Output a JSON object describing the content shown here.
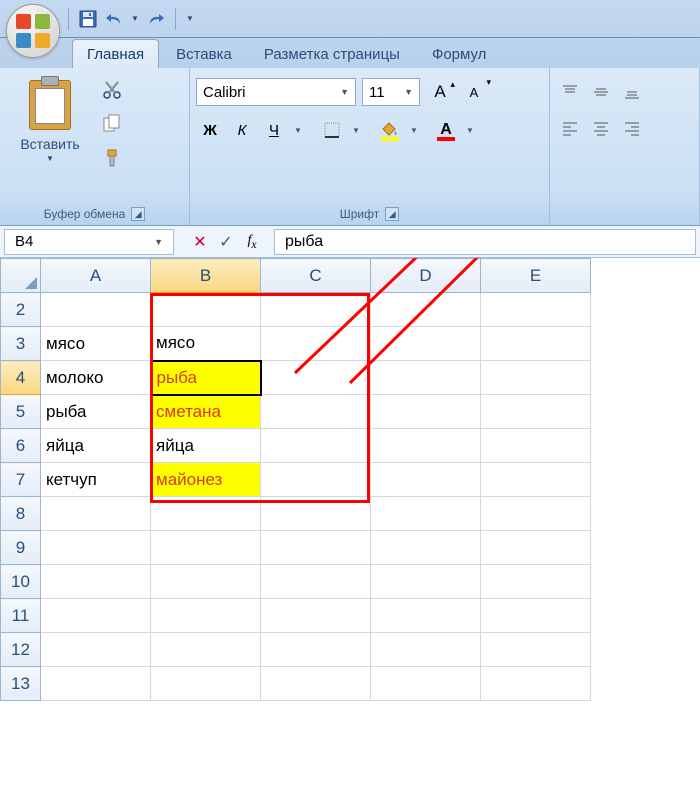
{
  "qat": {
    "save": "save-icon",
    "undo": "undo-icon",
    "redo": "redo-icon"
  },
  "tabs": {
    "home": "Главная",
    "insert": "Вставка",
    "pagelayout": "Разметка страницы",
    "formulas": "Формул"
  },
  "clipboard": {
    "paste": "Вставить",
    "title": "Буфер обмена"
  },
  "font": {
    "name": "Calibri",
    "size": "11",
    "title": "Шрифт",
    "bold": "Ж",
    "italic": "К",
    "underline": "Ч",
    "grow": "A",
    "shrink": "A",
    "fill_color": "#ffff00",
    "font_color": "#ff0000",
    "colorA": "A"
  },
  "formula": {
    "namebox": "B4",
    "value": "рыба"
  },
  "columns": [
    "A",
    "B",
    "C",
    "D",
    "E"
  ],
  "rows": [
    {
      "n": "2",
      "A": "",
      "B": "",
      "hl": false
    },
    {
      "n": "3",
      "A": "мясо",
      "B": "мясо",
      "hl": false
    },
    {
      "n": "4",
      "A": "молоко",
      "B": "рыба",
      "hl": true,
      "active": true
    },
    {
      "n": "5",
      "A": "рыба",
      "B": "сметана",
      "hl": true
    },
    {
      "n": "6",
      "A": "яйца",
      "B": "яйца",
      "hl": false
    },
    {
      "n": "7",
      "A": "кетчуп",
      "B": "майонез",
      "hl": true
    },
    {
      "n": "8",
      "A": "",
      "B": "",
      "hl": false
    },
    {
      "n": "9",
      "A": "",
      "B": "",
      "hl": false
    },
    {
      "n": "10",
      "A": "",
      "B": "",
      "hl": false
    },
    {
      "n": "11",
      "A": "",
      "B": "",
      "hl": false
    },
    {
      "n": "12",
      "A": "",
      "B": "",
      "hl": false
    },
    {
      "n": "13",
      "A": "",
      "B": "",
      "hl": false
    }
  ]
}
